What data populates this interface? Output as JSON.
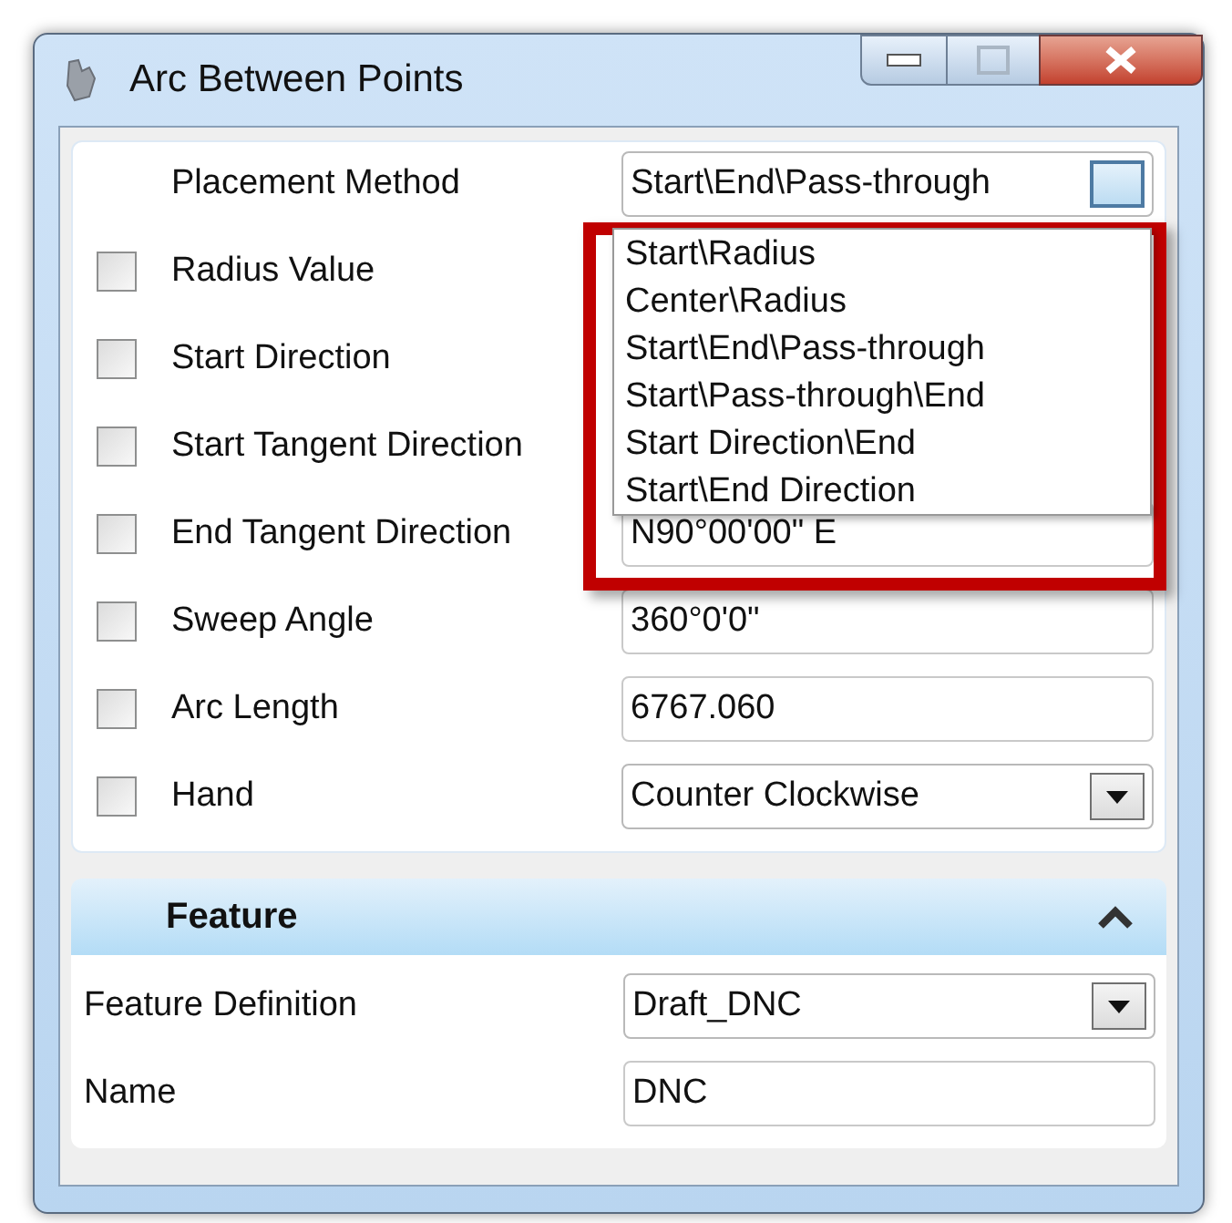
{
  "window": {
    "title": "Arc Between Points"
  },
  "parameters": [
    {
      "label": "Placement Method",
      "kind": "plain",
      "field": {
        "kind": "dropdown",
        "value": "Start\\End\\Pass-through",
        "open": true
      }
    },
    {
      "label": "Radius Value",
      "kind": "checkbox",
      "checked": false
    },
    {
      "label": "Start Direction",
      "kind": "checkbox",
      "checked": false
    },
    {
      "label": "Start Tangent Direction",
      "kind": "checkbox",
      "checked": false
    },
    {
      "label": "End Tangent Direction",
      "kind": "checkbox",
      "checked": false,
      "field": {
        "kind": "text",
        "value": "N90°00'00\" E"
      }
    },
    {
      "label": "Sweep Angle",
      "kind": "checkbox",
      "checked": false,
      "field": {
        "kind": "text",
        "value": "360°0'0\""
      }
    },
    {
      "label": "Arc Length",
      "kind": "checkbox",
      "checked": false,
      "field": {
        "kind": "text",
        "value": "6767.060"
      }
    },
    {
      "label": "Hand",
      "kind": "checkbox",
      "checked": false,
      "field": {
        "kind": "dropdown",
        "value": "Counter Clockwise",
        "open": false
      }
    }
  ],
  "dropdown_list": [
    "Start\\Radius",
    "Center\\Radius",
    "Start\\End\\Pass-through",
    "Start\\Pass-through\\End",
    "Start Direction\\End",
    "Start\\End Direction"
  ],
  "feature_section": {
    "title": "Feature",
    "expanded": true,
    "fields": [
      {
        "label": "Feature Definition",
        "field": {
          "kind": "dropdown",
          "value": "Draft_DNC",
          "open": false
        }
      },
      {
        "label": "Name",
        "field": {
          "kind": "text",
          "value": "DNC"
        }
      }
    ]
  }
}
